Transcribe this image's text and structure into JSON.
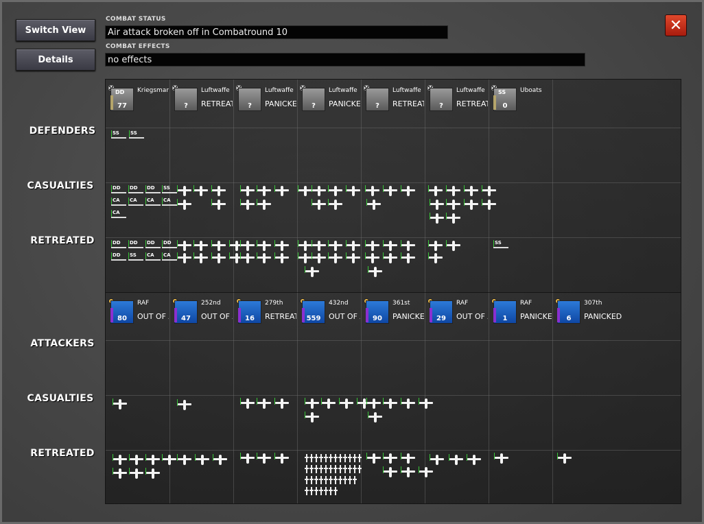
{
  "toolbar": {
    "switch_view_label": "Switch View",
    "details_label": "Details",
    "close_label": "✕"
  },
  "combat_status": {
    "label": "COMBAT STATUS",
    "value": "Air attack broken off in Combatround  10"
  },
  "combat_effects": {
    "label": "COMBAT EFFECTS",
    "value": "no effects"
  },
  "row_labels": {
    "defenders": "DEFENDERS",
    "def_casualties": "CASUALTIES",
    "def_retreated": "RETREATED",
    "attackers": "ATTACKERS",
    "att_casualties": "CASUALTIES",
    "att_retreated": "RETREATED"
  },
  "defenders": [
    {
      "nation": "Kriegsmarine",
      "code": "DD",
      "count": "77",
      "status": ""
    },
    {
      "nation": "Luftwaffe",
      "code": "",
      "count": "?",
      "status": "RETREATED"
    },
    {
      "nation": "Luftwaffe",
      "code": "",
      "count": "?",
      "status": "PANICKED"
    },
    {
      "nation": "Luftwaffe",
      "code": "",
      "count": "?",
      "status": "PANICKED"
    },
    {
      "nation": "Luftwaffe",
      "code": "",
      "count": "?",
      "status": "RETREATED"
    },
    {
      "nation": "Luftwaffe",
      "code": "",
      "count": "?",
      "status": "RETREATED"
    },
    {
      "nation": "Uboats",
      "code": "SS",
      "count": "0",
      "status": ""
    }
  ],
  "attackers": [
    {
      "nation": "RAF",
      "count": "80",
      "status": "OUT OF AMMO"
    },
    {
      "nation": "252nd",
      "count": "47",
      "status": "OUT OF AMMO"
    },
    {
      "nation": "279th",
      "count": "16",
      "status": "RETREATED"
    },
    {
      "nation": "432nd",
      "count": "559",
      "status": "OUT OF AMMO"
    },
    {
      "nation": "361st",
      "count": "90",
      "status": "PANICKED"
    },
    {
      "nation": "RAF",
      "count": "29",
      "status": "OUT OF AMMO"
    },
    {
      "nation": "RAF",
      "count": "1",
      "status": "PANICKED"
    },
    {
      "nation": "307th",
      "count": "6",
      "status": "PANICKED"
    }
  ],
  "ship_labels": {
    "def_remaining": [
      "SS",
      "SS"
    ],
    "def_casualties": [
      "DD",
      "DD",
      "DD",
      "SS",
      "CA",
      "CA",
      "CA",
      "CA",
      "CA"
    ],
    "def_retreated": [
      "DD",
      "DD",
      "DD",
      "DD",
      "DD",
      "SS",
      "CA",
      "CA",
      "SS"
    ]
  },
  "colors": {
    "accent_close": "#c8301c",
    "counter_blue": "#1a5cc0",
    "friendly_marker": "#37c837",
    "german_strip": "#b4a46a",
    "allied_strip": "#8a2fd0"
  }
}
